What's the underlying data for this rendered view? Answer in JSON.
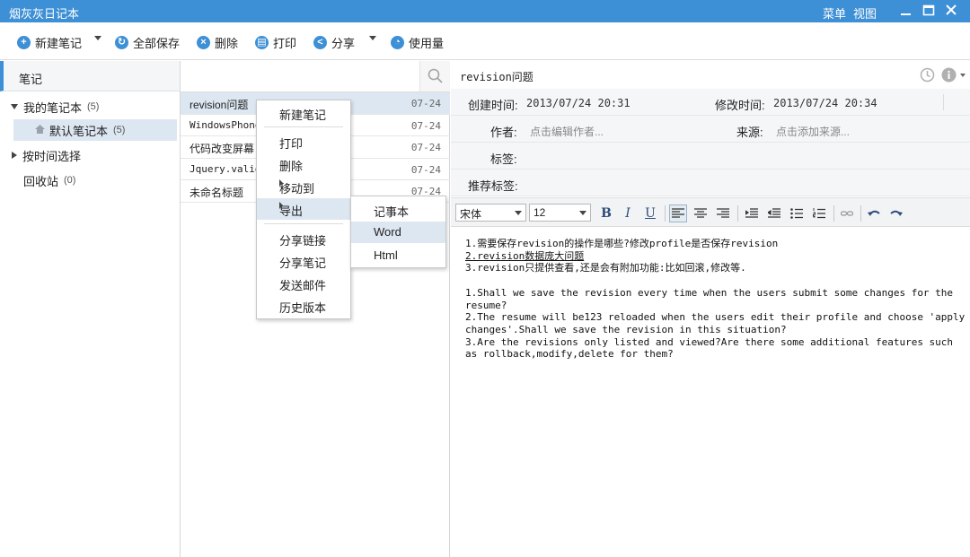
{
  "app": {
    "title": "烟灰灰日记本",
    "menu_label": "菜单",
    "view_label": "视图"
  },
  "toolbar": {
    "new_note": "新建笔记",
    "save_all": "全部保存",
    "delete": "删除",
    "print": "打印",
    "share": "分享",
    "usage": "使用量"
  },
  "sidebar": {
    "header": "笔记",
    "my_notebooks": "我的笔记本",
    "my_notebooks_count": "(5)",
    "default_notebook": "默认笔记本",
    "default_notebook_count": "(5)",
    "by_time": "按时间选择",
    "recycle": "回收站",
    "recycle_count": "(0)"
  },
  "notes": [
    {
      "title": "revision问题",
      "date": "07-24"
    },
    {
      "title": "WindowsPhone",
      "date": "07-24"
    },
    {
      "title": "代码改变屏幕",
      "date": "07-24"
    },
    {
      "title": "Jquery.valid",
      "date": "07-24"
    },
    {
      "title": "未命名标题",
      "date": "07-24"
    }
  ],
  "context_menu": {
    "new_note": "新建笔记",
    "print": "打印",
    "delete": "删除",
    "move_to": "移动到",
    "export": "导出",
    "share_link": "分享链接",
    "share_note": "分享笔记",
    "send_mail": "发送邮件",
    "history": "历史版本"
  },
  "export_submenu": {
    "notepad": "记事本",
    "word": "Word",
    "html": "Html"
  },
  "editor": {
    "title": "revision问题",
    "created_label": "创建时间:",
    "created_value": "2013/07/24 20:31",
    "modified_label": "修改时间:",
    "modified_value": "2013/07/24 20:34",
    "author_label": "作者:",
    "author_placeholder": "点击编辑作者...",
    "source_label": "来源:",
    "source_placeholder": "点击添加来源...",
    "tags_label": "标签:",
    "recommended_tags_label": "推荐标签:",
    "font_name": "宋体",
    "font_size": "12",
    "content_lines": [
      "1.需要保存revision的操作是哪些?修改profile是否保存revision",
      "2.revision数据庞大问题",
      "3.revision只提供查看,还是会有附加功能:比如回滚,修改等.",
      "",
      "1.Shall we save the revision every time when the users submit some changes for the resume?",
      "2.The resume will be123 reloaded when the users edit their profile and choose 'apply changes'.Shall we save the revision in this situation?",
      "3.Are the revisions only listed and viewed?Are there some additional features such as rollback,modify,delete for them?"
    ]
  },
  "colors": {
    "accent": "#3d8fd6",
    "selection": "#dde7f2"
  }
}
